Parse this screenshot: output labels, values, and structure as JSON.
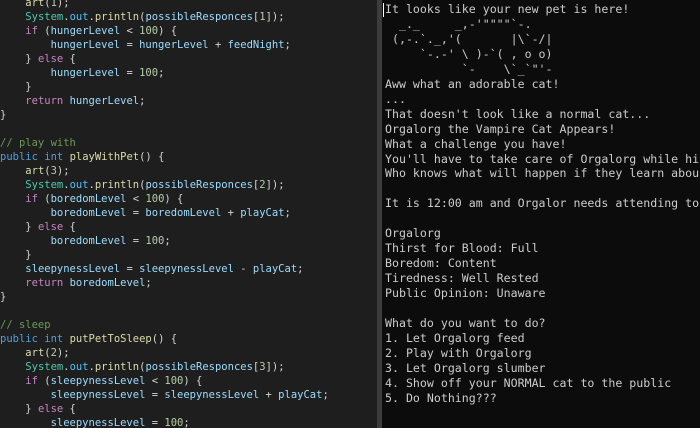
{
  "colors": {
    "editor_bg": "#1e1e1e",
    "keyword": "#569cd6",
    "control": "#c586c0",
    "method": "#dcdcaa",
    "variable": "#9cdcfe",
    "field": "#4fc1ff",
    "class": "#4ec9b0",
    "number": "#b5cea8",
    "comment": "#6a9955",
    "plain": "#d4d4d4",
    "terminal_bg": "#0c0c0c",
    "terminal_text": "#cccccc"
  },
  "editor": {
    "lines": [
      [
        {
          "t": "    "
        },
        {
          "t": "art",
          "c": "method"
        },
        {
          "t": "("
        },
        {
          "t": "1",
          "c": "number"
        },
        {
          "t": ");"
        }
      ],
      [
        {
          "t": "    "
        },
        {
          "t": "System",
          "c": "class"
        },
        {
          "t": "."
        },
        {
          "t": "out",
          "c": "field"
        },
        {
          "t": "."
        },
        {
          "t": "println",
          "c": "method"
        },
        {
          "t": "("
        },
        {
          "t": "possibleResponces",
          "c": "variable"
        },
        {
          "t": "["
        },
        {
          "t": "1",
          "c": "number"
        },
        {
          "t": "]);"
        }
      ],
      [
        {
          "t": "    "
        },
        {
          "t": "if",
          "c": "control"
        },
        {
          "t": " ("
        },
        {
          "t": "hungerLevel",
          "c": "variable"
        },
        {
          "t": " < "
        },
        {
          "t": "100",
          "c": "number"
        },
        {
          "t": ") {"
        }
      ],
      [
        {
          "t": "        "
        },
        {
          "t": "hungerLevel",
          "c": "variable"
        },
        {
          "t": " = "
        },
        {
          "t": "hungerLevel",
          "c": "variable"
        },
        {
          "t": " + "
        },
        {
          "t": "feedNight",
          "c": "variable"
        },
        {
          "t": ";"
        }
      ],
      [
        {
          "t": "    } "
        },
        {
          "t": "else",
          "c": "control"
        },
        {
          "t": " {"
        }
      ],
      [
        {
          "t": "        "
        },
        {
          "t": "hungerLevel",
          "c": "variable"
        },
        {
          "t": " = "
        },
        {
          "t": "100",
          "c": "number"
        },
        {
          "t": ";"
        }
      ],
      [
        {
          "t": "    }"
        }
      ],
      [
        {
          "t": "    "
        },
        {
          "t": "return",
          "c": "control"
        },
        {
          "t": " "
        },
        {
          "t": "hungerLevel",
          "c": "variable"
        },
        {
          "t": ";"
        }
      ],
      [
        {
          "t": "}"
        }
      ],
      [],
      [
        {
          "t": "// play with",
          "c": "comment"
        }
      ],
      [
        {
          "t": "public",
          "c": "keyword"
        },
        {
          "t": " "
        },
        {
          "t": "int",
          "c": "keyword"
        },
        {
          "t": " "
        },
        {
          "t": "playWithPet",
          "c": "method"
        },
        {
          "t": "() {"
        }
      ],
      [
        {
          "t": "    "
        },
        {
          "t": "art",
          "c": "method"
        },
        {
          "t": "("
        },
        {
          "t": "3",
          "c": "number"
        },
        {
          "t": ");"
        }
      ],
      [
        {
          "t": "    "
        },
        {
          "t": "System",
          "c": "class"
        },
        {
          "t": "."
        },
        {
          "t": "out",
          "c": "field"
        },
        {
          "t": "."
        },
        {
          "t": "println",
          "c": "method"
        },
        {
          "t": "("
        },
        {
          "t": "possibleResponces",
          "c": "variable"
        },
        {
          "t": "["
        },
        {
          "t": "2",
          "c": "number"
        },
        {
          "t": "]);"
        }
      ],
      [
        {
          "t": "    "
        },
        {
          "t": "if",
          "c": "control"
        },
        {
          "t": " ("
        },
        {
          "t": "boredomLevel",
          "c": "variable"
        },
        {
          "t": " < "
        },
        {
          "t": "100",
          "c": "number"
        },
        {
          "t": ") {"
        }
      ],
      [
        {
          "t": "        "
        },
        {
          "t": "boredomLevel",
          "c": "variable"
        },
        {
          "t": " = "
        },
        {
          "t": "boredomLevel",
          "c": "variable"
        },
        {
          "t": " + "
        },
        {
          "t": "playCat",
          "c": "variable"
        },
        {
          "t": ";"
        }
      ],
      [
        {
          "t": "    } "
        },
        {
          "t": "else",
          "c": "control"
        },
        {
          "t": " {"
        }
      ],
      [
        {
          "t": "        "
        },
        {
          "t": "boredomLevel",
          "c": "variable"
        },
        {
          "t": " = "
        },
        {
          "t": "100",
          "c": "number"
        },
        {
          "t": ";"
        }
      ],
      [
        {
          "t": "    }"
        }
      ],
      [
        {
          "t": "    "
        },
        {
          "t": "sleepynessLevel",
          "c": "variable"
        },
        {
          "t": " = "
        },
        {
          "t": "sleepynessLevel",
          "c": "variable"
        },
        {
          "t": " - "
        },
        {
          "t": "playCat",
          "c": "variable"
        },
        {
          "t": ";"
        }
      ],
      [
        {
          "t": "    "
        },
        {
          "t": "return",
          "c": "control"
        },
        {
          "t": " "
        },
        {
          "t": "boredomLevel",
          "c": "variable"
        },
        {
          "t": ";"
        }
      ],
      [
        {
          "t": "}"
        }
      ],
      [],
      [
        {
          "t": "// sleep",
          "c": "comment"
        }
      ],
      [
        {
          "t": "public",
          "c": "keyword"
        },
        {
          "t": " "
        },
        {
          "t": "int",
          "c": "keyword"
        },
        {
          "t": " "
        },
        {
          "t": "putPetToSleep",
          "c": "method"
        },
        {
          "t": "() {"
        }
      ],
      [
        {
          "t": "    "
        },
        {
          "t": "art",
          "c": "method"
        },
        {
          "t": "("
        },
        {
          "t": "2",
          "c": "number"
        },
        {
          "t": ");"
        }
      ],
      [
        {
          "t": "    "
        },
        {
          "t": "System",
          "c": "class"
        },
        {
          "t": "."
        },
        {
          "t": "out",
          "c": "field"
        },
        {
          "t": "."
        },
        {
          "t": "println",
          "c": "method"
        },
        {
          "t": "("
        },
        {
          "t": "possibleResponces",
          "c": "variable"
        },
        {
          "t": "["
        },
        {
          "t": "3",
          "c": "number"
        },
        {
          "t": "]);"
        }
      ],
      [
        {
          "t": "    "
        },
        {
          "t": "if",
          "c": "control"
        },
        {
          "t": " ("
        },
        {
          "t": "sleepynessLevel",
          "c": "variable"
        },
        {
          "t": " < "
        },
        {
          "t": "100",
          "c": "number"
        },
        {
          "t": ") {"
        }
      ],
      [
        {
          "t": "        "
        },
        {
          "t": "sleepynessLevel",
          "c": "variable"
        },
        {
          "t": " = "
        },
        {
          "t": "sleepynessLevel",
          "c": "variable"
        },
        {
          "t": " + "
        },
        {
          "t": "playCat",
          "c": "variable"
        },
        {
          "t": ";"
        }
      ],
      [
        {
          "t": "    } "
        },
        {
          "t": "else",
          "c": "control"
        },
        {
          "t": " {"
        }
      ],
      [
        {
          "t": "        "
        },
        {
          "t": "sleepynessLevel",
          "c": "variable"
        },
        {
          "t": " = "
        },
        {
          "t": "100",
          "c": "number"
        },
        {
          "t": ";"
        }
      ]
    ]
  },
  "terminal": {
    "lines": [
      "It looks like your new pet is here!",
      "  _._     _,-'\"\"\"\"`-.",
      " (,-.`._,'(       |\\`-/|",
      "     `-.-' \\ )-`( , o o)",
      "           `-    \\`_`\"'-",
      "Aww what an adorable cat!",
      "...",
      "That doesn't look like a normal cat...",
      "Orgalorg the Vampire Cat Appears!",
      "What a challenge you have!",
      "You'll have to take care of Orgalorg while hi",
      "Who knows what will happen if they learn abou",
      "",
      "It is 12:00 am and Orgalor needs attending to",
      "",
      "Orgalorg",
      "Thirst for Blood: Full",
      "Boredom: Content",
      "Tiredness: Well Rested",
      "Public Opinion: Unaware",
      "",
      "What do you want to do?",
      "1. Let Orgalorg feed",
      "2. Play with Orgalorg",
      "3. Let Orgalorg slumber",
      "4. Show off your NORMAL cat to the public",
      "5. Do Nothing???"
    ]
  }
}
